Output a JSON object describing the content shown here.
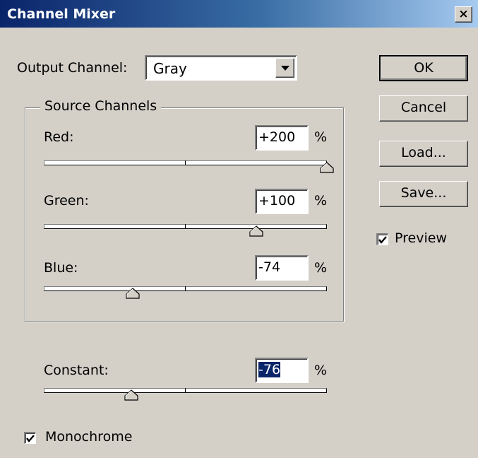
{
  "window": {
    "title": "Channel Mixer",
    "close_glyph": "×"
  },
  "output_channel": {
    "label": "Output Channel:",
    "value": "Gray"
  },
  "source_channels": {
    "legend": "Source Channels",
    "channels": [
      {
        "label": "Red:",
        "value": "+200",
        "unit": "%",
        "percent": 200
      },
      {
        "label": "Green:",
        "value": "+100",
        "unit": "%",
        "percent": 100
      },
      {
        "label": "Blue:",
        "value": "-74",
        "unit": "%",
        "percent": -74
      }
    ]
  },
  "constant": {
    "label": "Constant:",
    "value": "-76",
    "unit": "%",
    "percent": -76
  },
  "monochrome": {
    "label": "Monochrome",
    "checked": true
  },
  "buttons": {
    "ok": "OK",
    "cancel": "Cancel",
    "load": "Load...",
    "save": "Save..."
  },
  "preview": {
    "label": "Preview",
    "checked": true
  },
  "icons": {
    "close": "close-icon",
    "dropdown": "chevron-down-icon",
    "thumb": "slider-thumb-icon",
    "check": "checkmark-icon"
  },
  "colors": {
    "title_start": "#0a246a",
    "title_end": "#a6caf0",
    "face": "#d4d0c8",
    "selection": "#0a246a"
  }
}
